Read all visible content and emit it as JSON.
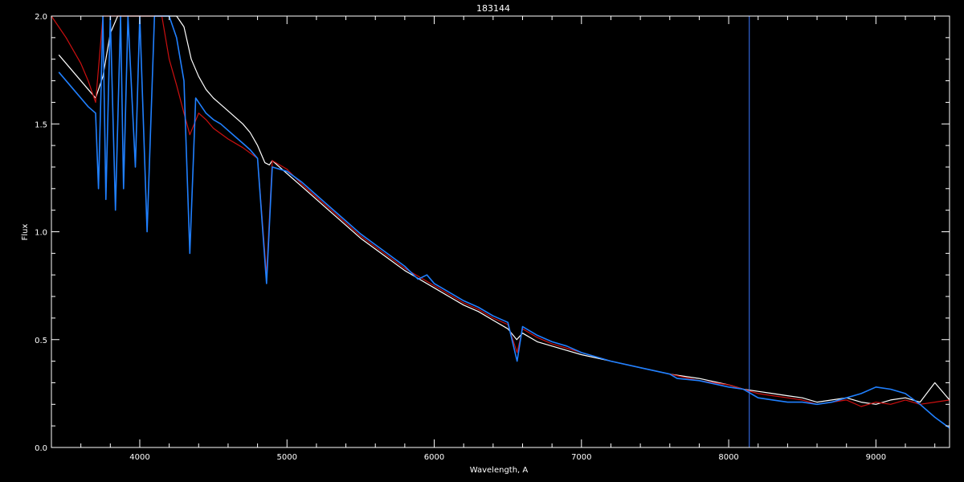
{
  "chart_data": {
    "type": "line",
    "title": "183144",
    "xlabel": "Wavelength, A",
    "ylabel": "Flux",
    "xlim": [
      3400,
      9500
    ],
    "ylim": [
      0,
      2.0
    ],
    "x_ticks": [
      4000,
      5000,
      6000,
      7000,
      8000,
      9000
    ],
    "x_tick_labels": [
      "4000",
      "5000",
      "6000",
      "7000",
      "8000",
      "9000"
    ],
    "y_ticks": [
      0.0,
      0.5,
      1.0,
      1.5,
      2.0
    ],
    "y_tick_labels": [
      "0.0",
      "0.5",
      "1.0",
      "1.5",
      "2.0"
    ],
    "grid": false,
    "background": "#000000",
    "axis_color": "#ffffff",
    "vertical_line": {
      "x": 8140,
      "color": "#3c78ff"
    },
    "series": [
      {
        "color": "#ffffff",
        "x": [
          3450,
          3550,
          3650,
          3700,
          3750,
          3800,
          3850,
          3900,
          3950,
          4000,
          4050,
          4100,
          4150,
          4200,
          4250,
          4300,
          4350,
          4400,
          4450,
          4500,
          4550,
          4600,
          4650,
          4700,
          4750,
          4800,
          4850,
          4880,
          4900,
          5000,
          5100,
          5200,
          5300,
          5400,
          5500,
          5600,
          5700,
          5800,
          5900,
          6000,
          6100,
          6200,
          6300,
          6400,
          6500,
          6560,
          6600,
          6700,
          6800,
          6900,
          7000,
          7200,
          7400,
          7600,
          7800,
          8000,
          8100,
          8200,
          8300,
          8400,
          8500,
          8600,
          8700,
          8800,
          8900,
          9000,
          9100,
          9200,
          9300,
          9400,
          9500
        ],
        "y": [
          1.82,
          1.74,
          1.66,
          1.62,
          1.72,
          1.92,
          2.0,
          2.0,
          2.0,
          2.0,
          2.0,
          2.0,
          2.0,
          2.0,
          2.0,
          1.95,
          1.8,
          1.72,
          1.66,
          1.62,
          1.59,
          1.56,
          1.53,
          1.5,
          1.46,
          1.4,
          1.32,
          1.31,
          1.33,
          1.27,
          1.21,
          1.15,
          1.09,
          1.03,
          0.97,
          0.92,
          0.87,
          0.82,
          0.78,
          0.74,
          0.7,
          0.66,
          0.63,
          0.59,
          0.55,
          0.5,
          0.53,
          0.49,
          0.47,
          0.45,
          0.43,
          0.4,
          0.37,
          0.34,
          0.32,
          0.29,
          0.27,
          0.26,
          0.25,
          0.24,
          0.23,
          0.21,
          0.22,
          0.23,
          0.21,
          0.2,
          0.22,
          0.23,
          0.21,
          0.3,
          0.22
        ]
      },
      {
        "color": "#cc1010",
        "x": [
          3400,
          3500,
          3600,
          3650,
          3700,
          3750,
          3800,
          3850,
          3900,
          3950,
          4000,
          4050,
          4100,
          4150,
          4200,
          4250,
          4300,
          4340,
          4400,
          4450,
          4500,
          4600,
          4700,
          4800,
          4861,
          4900,
          5000,
          5100,
          5200,
          5300,
          5400,
          5500,
          5600,
          5700,
          5800,
          5900,
          6000,
          6100,
          6200,
          6300,
          6400,
          6500,
          6563,
          6600,
          6700,
          6800,
          6900,
          7000,
          7200,
          7400,
          7600,
          7800,
          8000,
          8100,
          8200,
          8300,
          8400,
          8500,
          8600,
          8700,
          8800,
          8900,
          9000,
          9100,
          9200,
          9300,
          9400,
          9500
        ],
        "y": [
          2.0,
          1.9,
          1.78,
          1.7,
          1.6,
          2.0,
          2.0,
          2.0,
          2.0,
          2.0,
          2.0,
          2.0,
          2.0,
          2.0,
          1.8,
          1.68,
          1.55,
          1.45,
          1.55,
          1.52,
          1.48,
          1.43,
          1.39,
          1.34,
          0.8,
          1.33,
          1.29,
          1.22,
          1.16,
          1.1,
          1.04,
          0.98,
          0.93,
          0.88,
          0.83,
          0.79,
          0.75,
          0.71,
          0.67,
          0.64,
          0.6,
          0.57,
          0.44,
          0.55,
          0.51,
          0.48,
          0.46,
          0.44,
          0.4,
          0.37,
          0.34,
          0.31,
          0.29,
          0.27,
          0.25,
          0.24,
          0.23,
          0.22,
          0.2,
          0.21,
          0.22,
          0.19,
          0.21,
          0.2,
          0.22,
          0.2,
          0.21,
          0.22
        ]
      },
      {
        "color": "#2080ff",
        "x": [
          3450,
          3550,
          3650,
          3700,
          3720,
          3750,
          3770,
          3800,
          3835,
          3870,
          3890,
          3920,
          3970,
          4000,
          4050,
          4100,
          4150,
          4200,
          4250,
          4300,
          4340,
          4380,
          4450,
          4500,
          4550,
          4600,
          4650,
          4700,
          4750,
          4800,
          4861,
          4900,
          5000,
          5100,
          5200,
          5300,
          5400,
          5500,
          5600,
          5700,
          5800,
          5890,
          5950,
          6000,
          6100,
          6200,
          6300,
          6400,
          6500,
          6563,
          6600,
          6700,
          6800,
          6900,
          7000,
          7200,
          7400,
          7600,
          7650,
          7800,
          8000,
          8100,
          8200,
          8300,
          8400,
          8500,
          8600,
          8700,
          8800,
          8900,
          9000,
          9100,
          9200,
          9300,
          9400,
          9500
        ],
        "y": [
          1.74,
          1.66,
          1.58,
          1.55,
          1.2,
          2.0,
          1.15,
          2.0,
          1.1,
          2.0,
          1.2,
          2.0,
          1.3,
          2.0,
          1.0,
          2.0,
          2.0,
          2.0,
          1.9,
          1.7,
          0.9,
          1.62,
          1.55,
          1.52,
          1.5,
          1.47,
          1.44,
          1.41,
          1.38,
          1.34,
          0.76,
          1.3,
          1.28,
          1.23,
          1.17,
          1.11,
          1.05,
          0.99,
          0.94,
          0.89,
          0.84,
          0.78,
          0.8,
          0.76,
          0.72,
          0.68,
          0.65,
          0.61,
          0.58,
          0.4,
          0.56,
          0.52,
          0.49,
          0.47,
          0.44,
          0.4,
          0.37,
          0.34,
          0.32,
          0.31,
          0.28,
          0.27,
          0.23,
          0.22,
          0.21,
          0.21,
          0.2,
          0.21,
          0.23,
          0.25,
          0.28,
          0.27,
          0.25,
          0.2,
          0.14,
          0.09
        ]
      }
    ]
  }
}
